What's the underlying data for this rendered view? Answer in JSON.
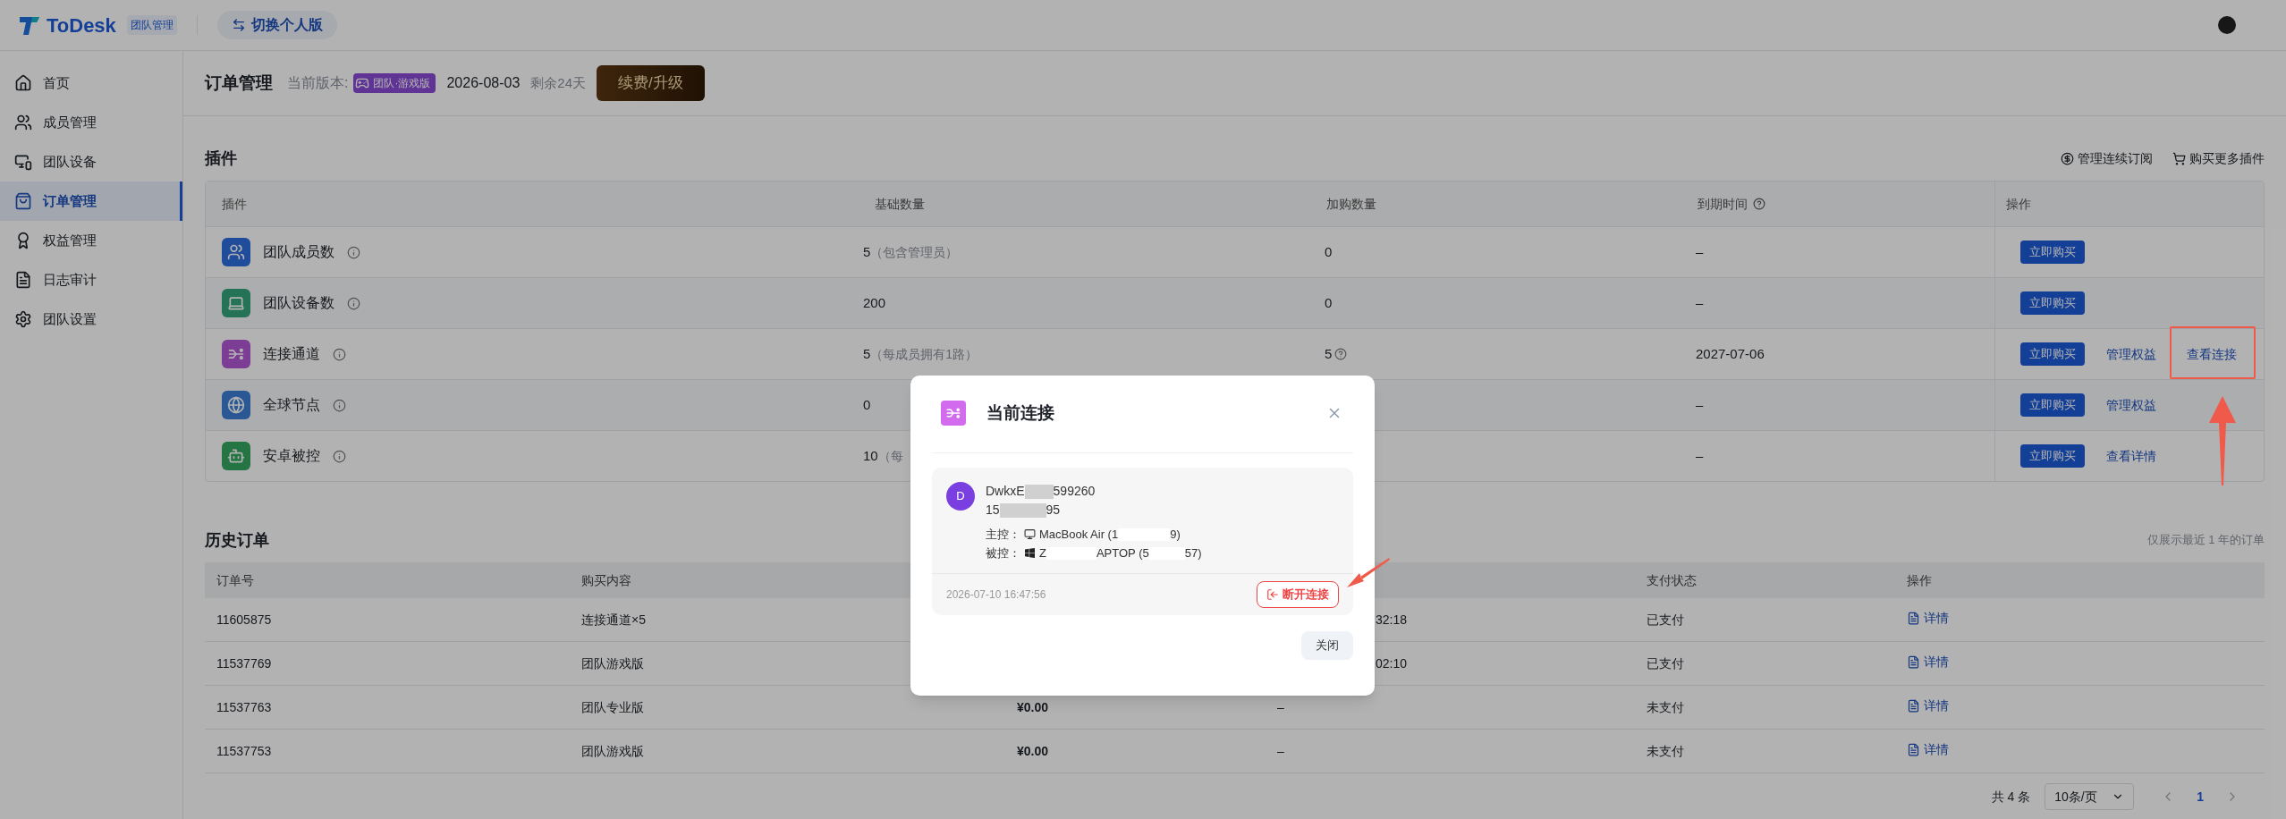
{
  "header": {
    "brand": "ToDesk",
    "brand_badge": "团队管理",
    "switch_button": "切换个人版"
  },
  "sidebar": {
    "items": [
      {
        "label": "首页",
        "selected": false
      },
      {
        "label": "成员管理",
        "selected": false
      },
      {
        "label": "团队设备",
        "selected": false
      },
      {
        "label": "订单管理",
        "selected": true
      },
      {
        "label": "权益管理",
        "selected": false
      },
      {
        "label": "日志审计",
        "selected": false
      },
      {
        "label": "团队设置",
        "selected": false
      }
    ]
  },
  "title_bar": {
    "title": "订单管理",
    "version_label": "当前版本:",
    "version_badge": "团队·游戏版",
    "expiry_date": "2026-08-03",
    "remaining": "剩余24天",
    "upgrade_button": "续费/升级"
  },
  "plugins": {
    "title": "插件",
    "links": [
      "管理连续订阅",
      "购买更多插件"
    ],
    "columns": [
      "插件",
      "基础数量",
      "加购数量",
      "到期时间",
      "操作"
    ],
    "rows": [
      {
        "name": "团队成员数",
        "base": "5",
        "base_note": "（包含管理员）",
        "extra": "0",
        "expiry": "–",
        "actions": [
          {
            "label": "立即购买",
            "kind": "button"
          }
        ]
      },
      {
        "name": "团队设备数",
        "base": "200",
        "extra": "0",
        "expiry": "–",
        "actions": [
          {
            "label": "立即购买",
            "kind": "button"
          }
        ]
      },
      {
        "name": "连接通道",
        "base": "5",
        "base_note": "（每成员拥有1路）",
        "extra": "5",
        "expiry": "2027-07-06",
        "actions": [
          {
            "label": "立即购买",
            "kind": "button"
          },
          {
            "label": "管理权益",
            "kind": "link"
          },
          {
            "label": "查看连接",
            "kind": "link"
          }
        ]
      },
      {
        "name": "全球节点",
        "base": "0",
        "expiry": "–",
        "actions": [
          {
            "label": "立即购买",
            "kind": "button"
          },
          {
            "label": "管理权益",
            "kind": "link"
          }
        ]
      },
      {
        "name": "安卓被控",
        "base": "10",
        "base_note": "（每",
        "expiry": "–",
        "actions": [
          {
            "label": "立即购买",
            "kind": "button"
          },
          {
            "label": "查看详情",
            "kind": "link"
          }
        ]
      }
    ]
  },
  "history": {
    "title": "历史订单",
    "note": "仅展示最近 1 年的订单",
    "headers": {
      "order_no": "订单号",
      "content": "购买内容",
      "status": "支付状态",
      "action": "操作"
    },
    "rows": [
      {
        "order_no": "11605875",
        "content": "连接通道×5",
        "time_tail": "32:18",
        "status": "已支付",
        "action": "详情"
      },
      {
        "order_no": "11537769",
        "content": "团队游戏版",
        "time_tail": "02:10",
        "status": "已支付",
        "action": "详情"
      },
      {
        "order_no": "11537763",
        "content": "团队专业版",
        "amount": "¥0.00",
        "time": "–",
        "status": "未支付",
        "action": "详情"
      },
      {
        "order_no": "11537753",
        "content": "团队游戏版",
        "amount": "¥0.00",
        "time": "–",
        "status": "未支付",
        "action": "详情"
      }
    ],
    "pagination": {
      "total": "共 4 条",
      "page_size": "10条/页",
      "pages": [
        {
          "label": "1",
          "selected": true
        }
      ]
    }
  },
  "modal": {
    "title": "当前连接",
    "avatar": "D",
    "name_start": "DwkxE",
    "name_end": "599260",
    "phone_start": "15",
    "phone_end": "95",
    "controller_label": "主控：",
    "controller_start": "MacBook Air (1",
    "controller_end": "9)",
    "controlled_label": "被控：",
    "controlled_start": "Z",
    "controlled_mid": "APTOP (5",
    "controlled_end": "57)",
    "time": "2026-07-10 16:47:56",
    "disconnect_button": "断开连接",
    "close_button": "关闭"
  }
}
